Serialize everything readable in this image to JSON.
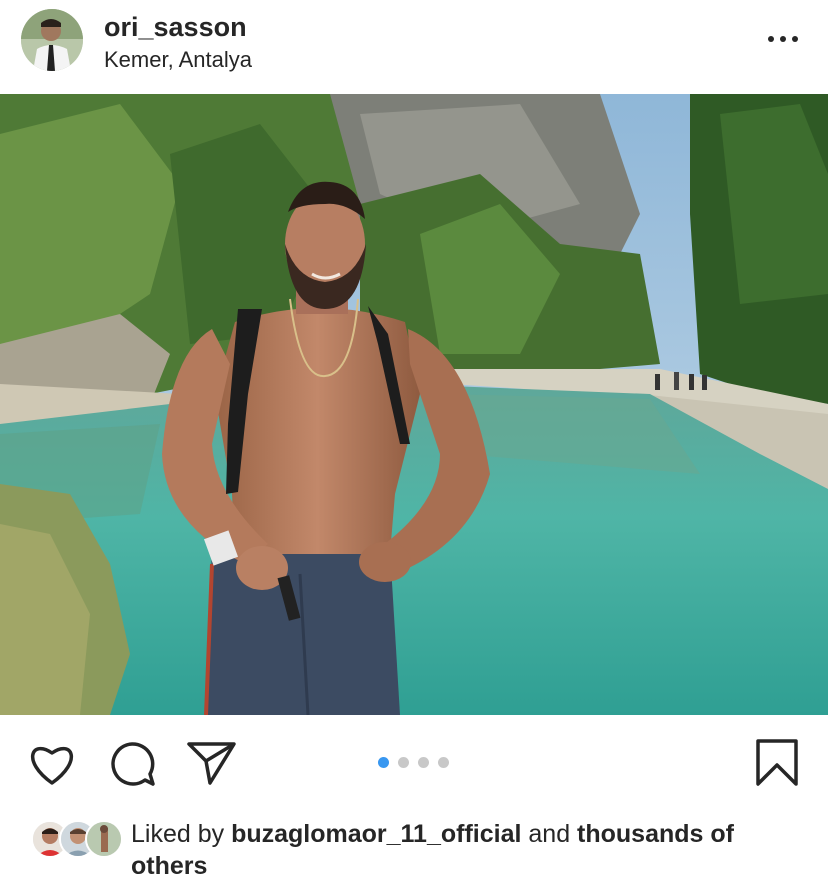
{
  "post": {
    "username": "ori_sasson",
    "location": "Kemer, Antalya"
  },
  "icons": {
    "more": "more-horizontal-icon",
    "like": "heart-icon",
    "comment": "comment-bubble-icon",
    "share": "paper-plane-icon",
    "save": "bookmark-icon"
  },
  "carousel": {
    "count": 4,
    "active_index": 1
  },
  "likes": {
    "prefix": "Liked by ",
    "user": "buzaglomaor_11_official",
    "middle": " and ",
    "others": "thousands of others"
  },
  "colors": {
    "text": "#262626",
    "accent": "#3897f0",
    "dot_inactive": "#c8c8c8"
  }
}
